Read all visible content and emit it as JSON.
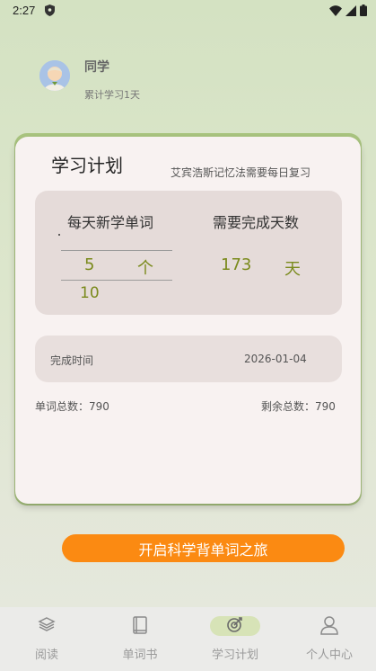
{
  "status": {
    "time": "2:27",
    "icons": [
      "shield-icon",
      "wifi-icon",
      "signal-icon",
      "battery-icon"
    ]
  },
  "profile": {
    "name": "同学",
    "days": "累计学习1天"
  },
  "plan": {
    "title": "学习计划",
    "tip": "艾宾浩斯记忆法需要每日复习",
    "daily_header": "每天新学单词",
    "days_header": "需要完成天数",
    "daily_value": "5",
    "daily_unit": "个",
    "daily_next": "10",
    "days_value": "173",
    "days_unit": "天",
    "finish_label": "完成时间",
    "finish_date": "2026-01-04",
    "total_words": "单词总数：790",
    "remaining": "剩余总数：790"
  },
  "start_button": "开启科学背单词之旅",
  "tabs": [
    {
      "label": "阅读",
      "icon": "layers-icon",
      "active": false
    },
    {
      "label": "单词书",
      "icon": "book-icon",
      "active": false
    },
    {
      "label": "学习计划",
      "icon": "target-icon",
      "active": true
    },
    {
      "label": "个人中心",
      "icon": "user-icon",
      "active": false
    }
  ],
  "colors": {
    "accent_orange": "#fb8a12",
    "accent_green": "#7a8a1c",
    "active_tab_pill": "#d7e3b7"
  }
}
